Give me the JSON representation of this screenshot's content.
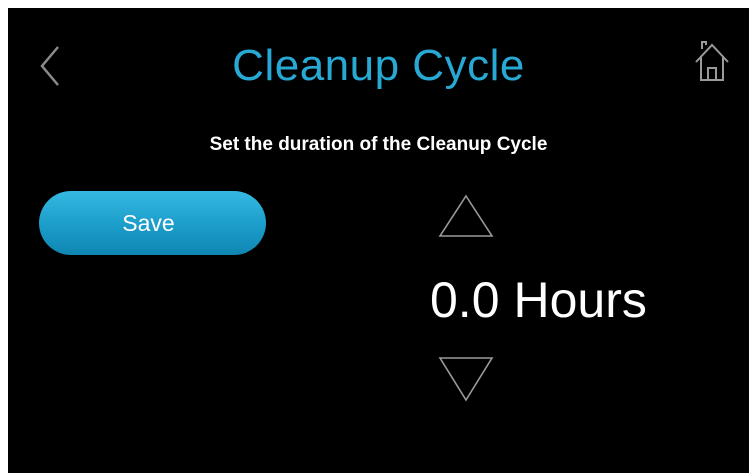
{
  "header": {
    "title": "Cleanup Cycle",
    "back_icon": "chevron-left-icon",
    "home_icon": "home-icon"
  },
  "instruction": "Set the duration of the Cleanup Cycle",
  "save_button": {
    "label": "Save"
  },
  "duration": {
    "value": "0.0",
    "unit": "Hours",
    "increase_icon": "triangle-up-icon",
    "decrease_icon": "triangle-down-icon"
  },
  "colors": {
    "background": "#000000",
    "title": "#27a9d4",
    "button": "#1b9cc9",
    "text": "#ffffff"
  }
}
